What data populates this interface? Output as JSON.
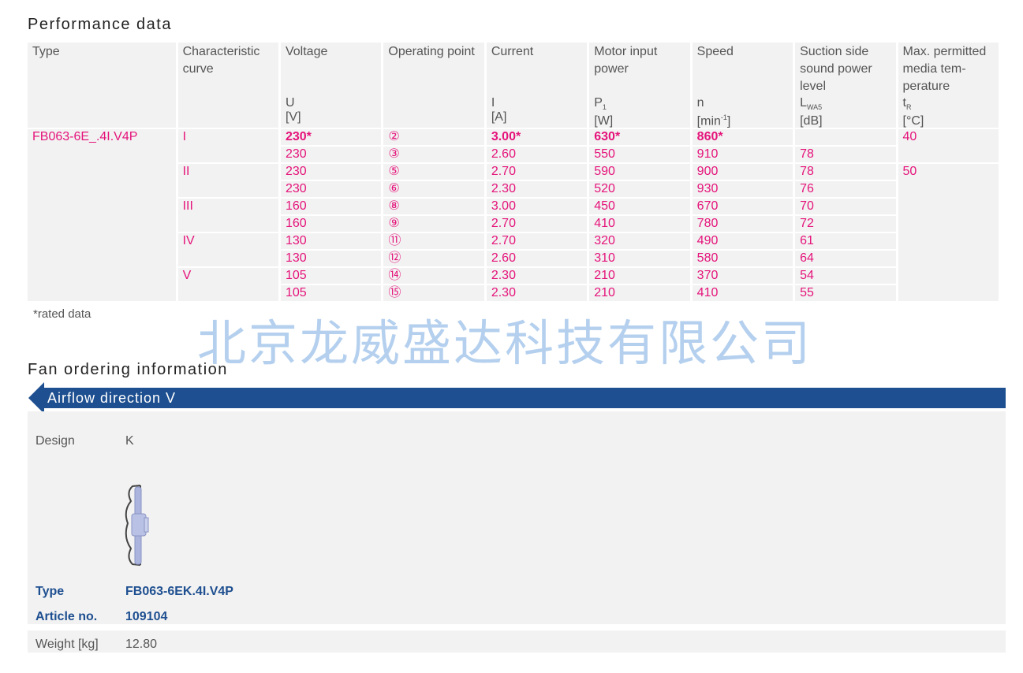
{
  "performance": {
    "title": "Performance data",
    "headers": {
      "type": "Type",
      "curve": "Characteristic curve",
      "voltage": "Voltage",
      "voltage_sym": "U",
      "voltage_unit": "[V]",
      "op": "Operating point",
      "current": "Current",
      "current_sym": "I",
      "current_unit": "[A]",
      "power": "Motor input power",
      "power_sym": "P",
      "power_sub": "1",
      "power_unit": "[W]",
      "speed": "Speed",
      "speed_sym": "n",
      "speed_unit": "[min",
      "speed_sup": "-1",
      "speed_unit_end": "]",
      "sound": "Suction side sound power level",
      "sound_sym": "L",
      "sound_sub": "WA5",
      "sound_unit": "[dB]",
      "temp": "Max. permitted media tem-perature",
      "temp_sym": "t",
      "temp_sub": "R",
      "temp_unit": "[°C]"
    },
    "type_value": "FB063-6E_.4I.V4P",
    "rows": [
      {
        "curve": "I",
        "u": "230*",
        "op": "②",
        "i": "3.00*",
        "p": "630*",
        "n": "860*",
        "l": "",
        "t": "40"
      },
      {
        "curve": "",
        "u": "230",
        "op": "③",
        "i": "2.60",
        "p": "550",
        "n": "910",
        "l": "78",
        "t": ""
      },
      {
        "curve": "II",
        "u": "230",
        "op": "⑤",
        "i": "2.70",
        "p": "590",
        "n": "900",
        "l": "78",
        "t": "50"
      },
      {
        "curve": "",
        "u": "230",
        "op": "⑥",
        "i": "2.30",
        "p": "520",
        "n": "930",
        "l": "76",
        "t": ""
      },
      {
        "curve": "III",
        "u": "160",
        "op": "⑧",
        "i": "3.00",
        "p": "450",
        "n": "670",
        "l": "70",
        "t": ""
      },
      {
        "curve": "",
        "u": "160",
        "op": "⑨",
        "i": "2.70",
        "p": "410",
        "n": "780",
        "l": "72",
        "t": ""
      },
      {
        "curve": "IV",
        "u": "130",
        "op": "⑪",
        "i": "2.70",
        "p": "320",
        "n": "490",
        "l": "61",
        "t": ""
      },
      {
        "curve": "",
        "u": "130",
        "op": "⑫",
        "i": "2.60",
        "p": "310",
        "n": "580",
        "l": "64",
        "t": ""
      },
      {
        "curve": "V",
        "u": "105",
        "op": "⑭",
        "i": "2.30",
        "p": "210",
        "n": "370",
        "l": "54",
        "t": ""
      },
      {
        "curve": "",
        "u": "105",
        "op": "⑮",
        "i": "2.30",
        "p": "210",
        "n": "410",
        "l": "55",
        "t": ""
      }
    ],
    "footnote": "*rated data"
  },
  "watermark": "北京龙威盛达科技有限公司",
  "ordering": {
    "title": "Fan ordering information",
    "airflow": "Airflow direction V",
    "design_label": "Design",
    "design_value": "K",
    "type_label": "Type",
    "type_value": "FB063-6EK.4I.V4P",
    "article_label": "Article no.",
    "article_value": "109104",
    "weight_label": "Weight [kg]",
    "weight_value": "12.80"
  },
  "colors": {
    "accent": "#e5137a",
    "brand_blue": "#1e4f90",
    "panel": "#f2f2f2"
  }
}
